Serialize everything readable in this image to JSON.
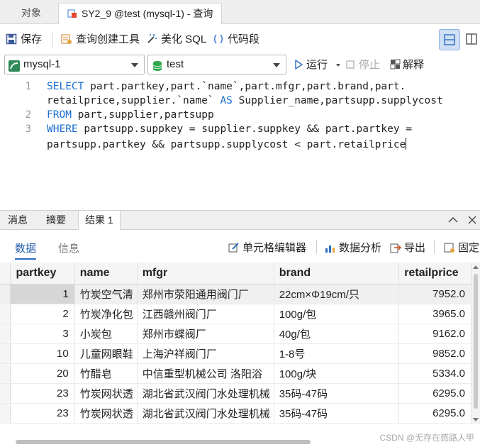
{
  "tabs": [
    {
      "label": "对象"
    },
    {
      "label": "SY2_9 @test (mysql-1) - 查询"
    }
  ],
  "toolbar": {
    "save": "保存",
    "query_builder": "查询创建工具",
    "beautify": "美化 SQL",
    "snippet": "代码段"
  },
  "connection": {
    "value": "mysql-1"
  },
  "database": {
    "value": "test"
  },
  "run": {
    "run": "运行",
    "stop": "停止",
    "explain": "解释"
  },
  "editor": {
    "line_numbers": [
      "1",
      "2",
      "3"
    ],
    "line1a": {
      "kw": "SELECT",
      "text": " part.partkey,part.`name`,part.mfgr,part.brand,part."
    },
    "line1b": {
      "text": "retailprice,supplier.`name` ",
      "kw": "AS",
      "text2": " Supplier_name,partsupp.supplycost"
    },
    "line2": {
      "kw": "FROM",
      "text": " part,supplier,partsupp"
    },
    "line3a": {
      "kw": "WHERE",
      "text": " partsupp.suppkey = supplier.suppkey && part.partkey ="
    },
    "line3b": {
      "text": "partsupp.partkey && partsupp.supplycost < part.retailprice"
    }
  },
  "panel_tabs": [
    {
      "label": "消息"
    },
    {
      "label": "摘要"
    },
    {
      "label": "结果 1"
    }
  ],
  "subbar": {
    "data": "数据",
    "info": "信息",
    "cell_editor": "单元格编辑器",
    "analysis": "数据分析",
    "export": "导出",
    "pin": "固定"
  },
  "grid": {
    "columns": [
      "partkey",
      "name",
      "mfgr",
      "brand",
      "retailprice"
    ],
    "rows": [
      [
        "1",
        "竹炭空气清",
        "郑州市荥阳通用阀门厂",
        "22cm×Φ19cm/只",
        "7952.0"
      ],
      [
        "2",
        "竹炭净化包",
        "江西赣州阀门厂",
        "100g/包",
        "3965.0"
      ],
      [
        "3",
        "小炭包",
        "郑州市蝶阀厂",
        "40g/包",
        "9162.0"
      ],
      [
        "10",
        "儿童网眼鞋",
        "上海沪祥阀门厂",
        "1-8号",
        "9852.0"
      ],
      [
        "20",
        "竹醋皂",
        "中信重型机械公司    洛阳浴",
        "100g/块",
        "5334.0"
      ],
      [
        "23",
        "竹炭网状透",
        "湖北省武汉阀门水处理机械",
        "35码-47码",
        "6295.0"
      ],
      [
        "23",
        "竹炭网状透",
        "湖北省武汉阀门水处理机械",
        "35码-47码",
        "6295.0"
      ]
    ]
  },
  "watermark": "CSDN @无存在感路人甲",
  "colors": {
    "keyword": "#1a6fd0",
    "accent": "#2d6dc4",
    "run_green": "#2e8b57"
  }
}
